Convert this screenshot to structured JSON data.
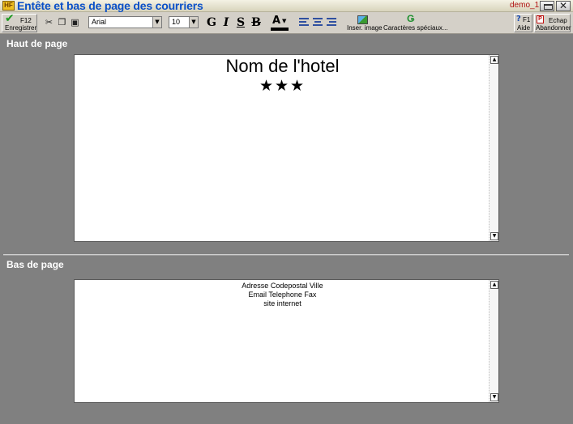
{
  "window": {
    "title": "Entête et bas de page des courriers",
    "user": "demo_1",
    "app_icon_text": "HF",
    "close_glyph": "✕"
  },
  "toolbar": {
    "save": {
      "key": "F12",
      "label": "Enregistrer",
      "icon": "check-icon"
    },
    "font_family": "Arial",
    "font_size": "10",
    "format_buttons": [
      "G",
      "I",
      "S",
      "B"
    ],
    "font_color_label": "A",
    "insert_image_label": "Inser. image",
    "special_chars_label": "Caractères spéciaux...",
    "help": {
      "key": "F1",
      "label": "Aide"
    },
    "cancel": {
      "key": "Echap",
      "label": "Abandonner"
    }
  },
  "header_section": {
    "title": "Haut de page",
    "content": {
      "hotel_name": "Nom de l'hotel",
      "stars": "★★★"
    }
  },
  "footer_section": {
    "title": "Bas de page",
    "content": {
      "address": "Adresse Codepostal Ville",
      "contact": "Email Telephone Fax",
      "website": "site internet"
    }
  },
  "colors": {
    "title_text": "#0a50c8",
    "user_text": "#b01010",
    "background": "#808080"
  }
}
